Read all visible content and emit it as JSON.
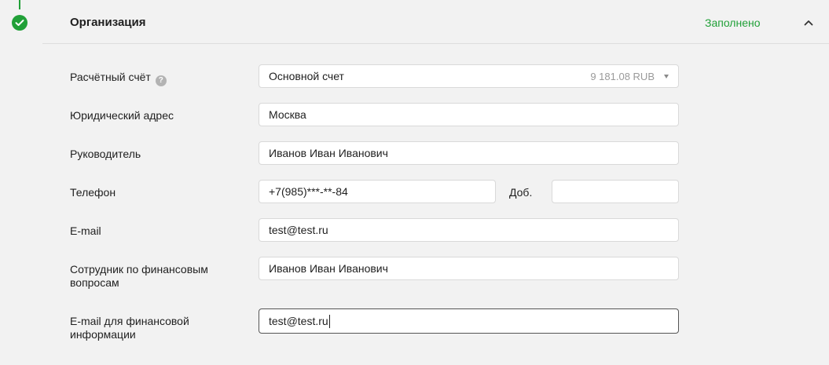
{
  "section": {
    "title": "Организация",
    "status": "Заполнено",
    "status_color": "#21a038",
    "step_icon": "check-icon",
    "collapse_icon": "chevron-up-icon"
  },
  "fields": {
    "account": {
      "label": "Расчётный счёт",
      "help_icon": "question-icon",
      "value": "Основной счет",
      "balance": "9 181.08 RUB"
    },
    "address": {
      "label": "Юридический адрес",
      "value": "Москва"
    },
    "head": {
      "label": "Руководитель",
      "value": "Иванов Иван Иванович"
    },
    "phone": {
      "label": "Телефон",
      "value": "+7(985)***-**-84",
      "ext_label": "Доб.",
      "ext_value": ""
    },
    "email": {
      "label": "E-mail",
      "value": "test@test.ru"
    },
    "finance_person": {
      "label_line1": "Сотрудник по финансовым",
      "label_line2": "вопросам",
      "value": "Иванов Иван Иванович"
    },
    "finance_email": {
      "label_line1": "E-mail для финансовой",
      "label_line2": "информации",
      "value": "test@test.ru"
    }
  }
}
